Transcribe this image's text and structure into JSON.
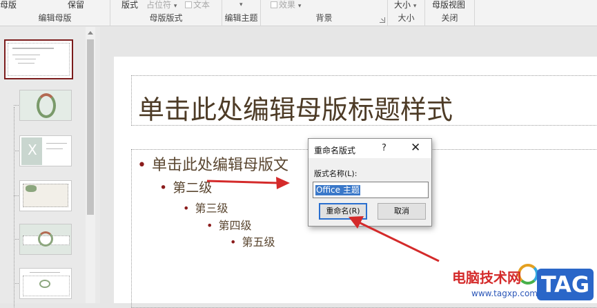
{
  "ribbon": {
    "groups": [
      {
        "controls": [
          "母版",
          "保留"
        ],
        "label": "编辑母版"
      },
      {
        "controls": [
          "版式",
          "占位符",
          "文本"
        ],
        "label": "母版版式"
      },
      {
        "controls": [],
        "label": "编辑主题"
      },
      {
        "controls": [
          "效果"
        ],
        "label": "背景"
      },
      {
        "controls": [
          "大小"
        ],
        "label": "大小"
      },
      {
        "controls": [
          "母版视图"
        ],
        "label": "关闭"
      }
    ]
  },
  "slide": {
    "title": "单击此处编辑母版标题样式",
    "levels": [
      "单击此处编辑母版文",
      "第二级",
      "第三级",
      "第四级",
      "第五级"
    ]
  },
  "dialog": {
    "title": "重命名版式",
    "help": "?",
    "close": "✕",
    "field_label": "版式名称(L):",
    "field_value": "Office 主题",
    "rename_button": "重命名(R)",
    "cancel_button": "取消"
  },
  "watermark": {
    "site_name": "电脑技术网",
    "tag": "TAG",
    "url": "www.tagxp.com"
  },
  "colors": {
    "accent": "#7b1c1c",
    "title_text": "#4d3b26",
    "arrow": "#d42a2a",
    "selection": "#3a78c9"
  },
  "icons": [
    "scroll-up-icon",
    "help-icon",
    "close-icon",
    "launcher-icon",
    "chevron-down-icon"
  ]
}
